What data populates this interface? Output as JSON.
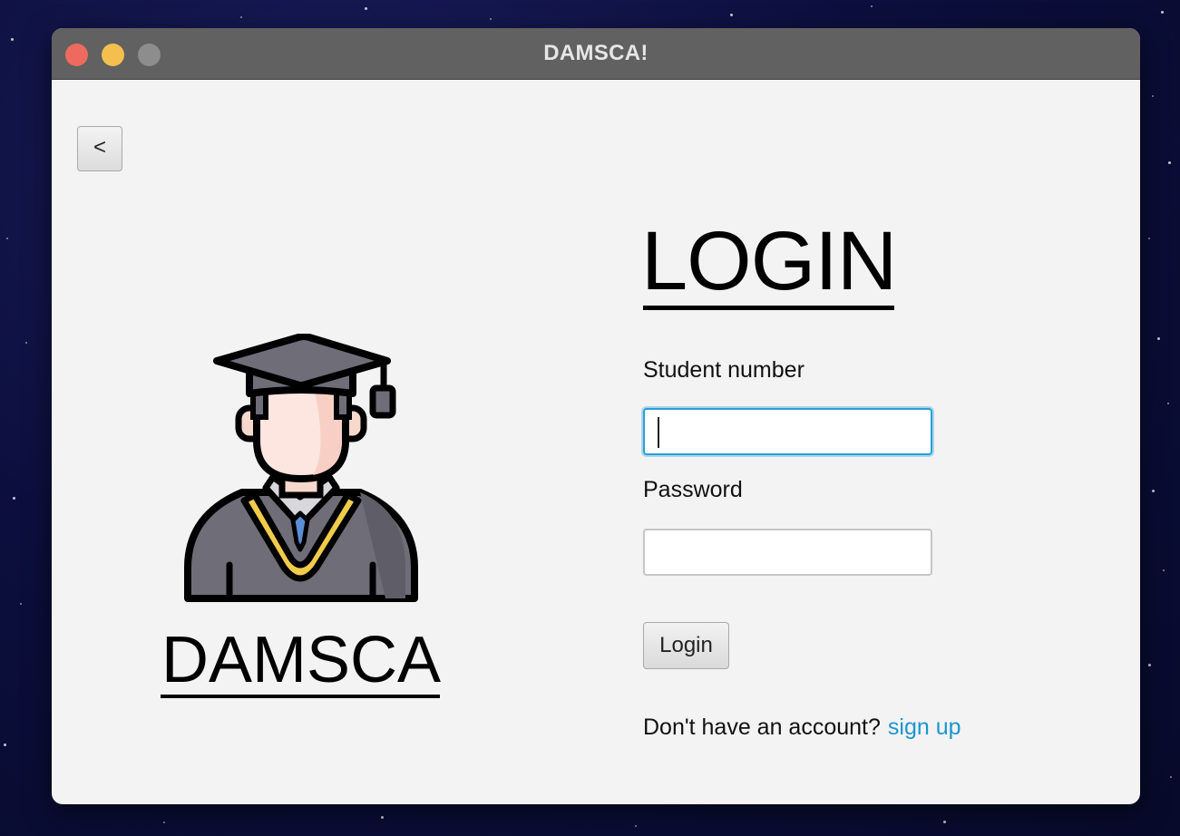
{
  "window": {
    "title": "DAMSCA!"
  },
  "back_button": {
    "label": "<"
  },
  "branding": {
    "name": "DAMSCA"
  },
  "login_form": {
    "heading": "LOGIN",
    "student_number_label": "Student number",
    "student_number_value": "",
    "password_label": "Password",
    "password_value": "",
    "submit_label": "Login",
    "no_account_text": "Don't have an account?",
    "signup_link": "sign up"
  },
  "colors": {
    "titlebar": "#616161",
    "focus_ring": "#2a9fd6",
    "link": "#1d95cf",
    "content_background": "#f3f3f3"
  }
}
